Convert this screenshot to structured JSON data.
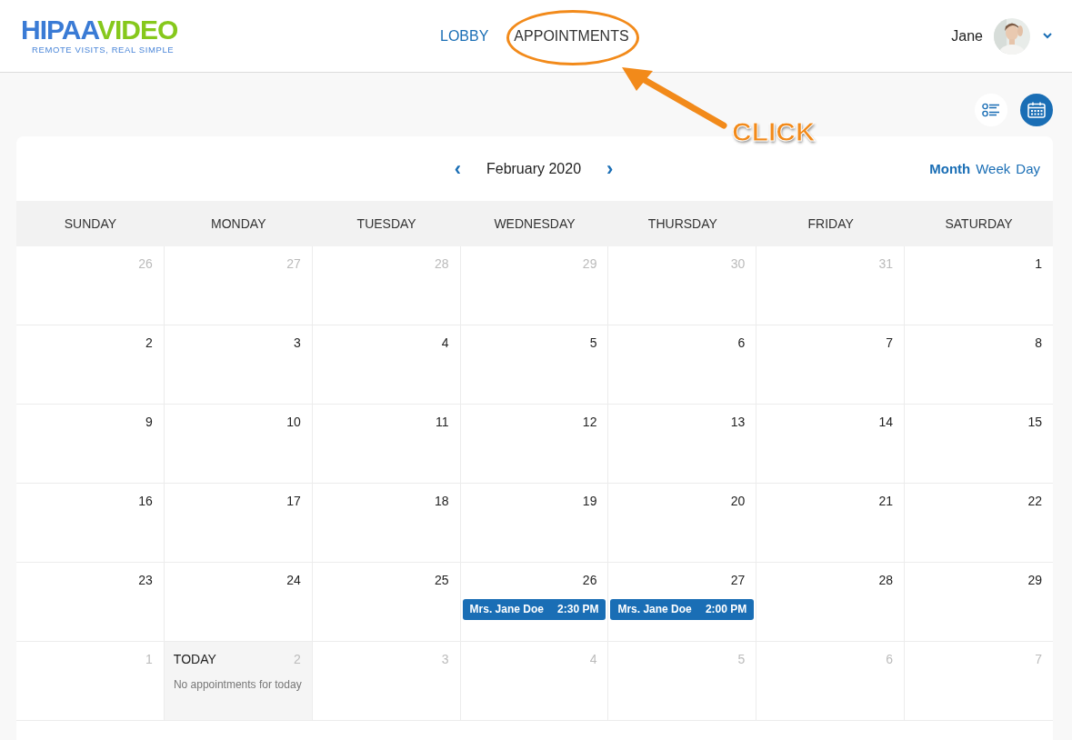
{
  "logo": {
    "brand_left": "HIPAA",
    "brand_right": "VIDEO",
    "tagline": "REMOTE VISITS, REAL SIMPLE"
  },
  "nav": [
    {
      "label": "LOBBY",
      "selected": false
    },
    {
      "label": "APPOINTMENTS",
      "selected": true
    }
  ],
  "user": {
    "name": "Jane"
  },
  "view_toggle": [
    {
      "kind": "list",
      "selected": false
    },
    {
      "kind": "calendar",
      "selected": true
    }
  ],
  "calendar": {
    "month_title": "February 2020",
    "prev": "‹",
    "next": "›",
    "modes": [
      {
        "label": "Month",
        "selected": true
      },
      {
        "label": "Week",
        "selected": false
      },
      {
        "label": "Day",
        "selected": false
      }
    ],
    "weekdays": [
      "SUNDAY",
      "MONDAY",
      "TUESDAY",
      "WEDNESDAY",
      "THURSDAY",
      "FRIDAY",
      "SATURDAY"
    ],
    "weeks": [
      [
        {
          "day": "26",
          "outside": true
        },
        {
          "day": "27",
          "outside": true
        },
        {
          "day": "28",
          "outside": true
        },
        {
          "day": "29",
          "outside": true
        },
        {
          "day": "30",
          "outside": true
        },
        {
          "day": "31",
          "outside": true
        },
        {
          "day": "1",
          "outside": false
        }
      ],
      [
        {
          "day": "2",
          "outside": false
        },
        {
          "day": "3",
          "outside": false
        },
        {
          "day": "4",
          "outside": false
        },
        {
          "day": "5",
          "outside": false
        },
        {
          "day": "6",
          "outside": false
        },
        {
          "day": "7",
          "outside": false
        },
        {
          "day": "8",
          "outside": false
        }
      ],
      [
        {
          "day": "9",
          "outside": false
        },
        {
          "day": "10",
          "outside": false
        },
        {
          "day": "11",
          "outside": false
        },
        {
          "day": "12",
          "outside": false
        },
        {
          "day": "13",
          "outside": false
        },
        {
          "day": "14",
          "outside": false
        },
        {
          "day": "15",
          "outside": false
        }
      ],
      [
        {
          "day": "16",
          "outside": false
        },
        {
          "day": "17",
          "outside": false
        },
        {
          "day": "18",
          "outside": false
        },
        {
          "day": "19",
          "outside": false
        },
        {
          "day": "20",
          "outside": false
        },
        {
          "day": "21",
          "outside": false
        },
        {
          "day": "22",
          "outside": false
        }
      ],
      [
        {
          "day": "23",
          "outside": false
        },
        {
          "day": "24",
          "outside": false
        },
        {
          "day": "25",
          "outside": false
        },
        {
          "day": "26",
          "outside": false,
          "events": [
            {
              "name": "Mrs. Jane Doe",
              "time": "2:30 PM"
            }
          ]
        },
        {
          "day": "27",
          "outside": false,
          "events": [
            {
              "name": "Mrs. Jane Doe",
              "time": "2:00 PM"
            }
          ]
        },
        {
          "day": "28",
          "outside": false
        },
        {
          "day": "29",
          "outside": false
        }
      ],
      [
        {
          "day": "1",
          "outside": true
        },
        {
          "day": "2",
          "outside": true,
          "today": true,
          "today_label": "TODAY",
          "note": "No appointments for today"
        },
        {
          "day": "3",
          "outside": true
        },
        {
          "day": "4",
          "outside": true
        },
        {
          "day": "5",
          "outside": true
        },
        {
          "day": "6",
          "outside": true
        },
        {
          "day": "7",
          "outside": true
        }
      ]
    ]
  },
  "annotation": {
    "text": "CLICK"
  }
}
